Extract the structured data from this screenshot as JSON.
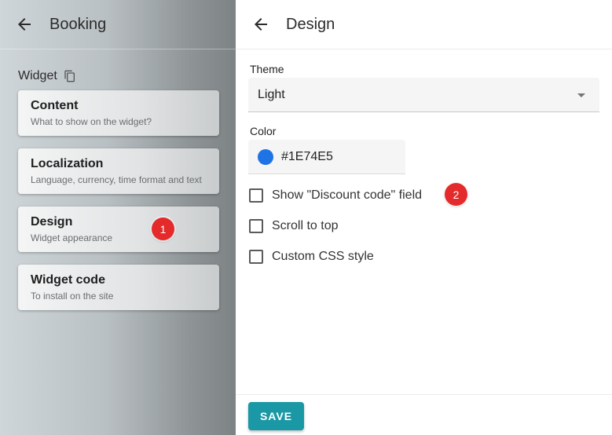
{
  "left_panel": {
    "title": "Booking",
    "section_label": "Widget",
    "cards": [
      {
        "title": "Content",
        "subtitle": "What to show on the widget?"
      },
      {
        "title": "Localization",
        "subtitle": "Language, currency, time format and text"
      },
      {
        "title": "Design",
        "subtitle": "Widget appearance"
      },
      {
        "title": "Widget code",
        "subtitle": "To install on the site"
      }
    ]
  },
  "right_panel": {
    "title": "Design",
    "theme": {
      "label": "Theme",
      "value": "Light"
    },
    "color": {
      "label": "Color",
      "value": "#1E74E5",
      "swatch": "#1E74E5"
    },
    "checkboxes": [
      {
        "label": "Show \"Discount code\" field",
        "checked": false
      },
      {
        "label": "Scroll to top",
        "checked": false
      },
      {
        "label": "Custom CSS style",
        "checked": false
      }
    ],
    "save_label": "SAVE"
  },
  "annotations": {
    "badge_1": "1",
    "badge_2": "2"
  },
  "colors": {
    "accent": "#1A98A5",
    "badge": "#E42A2A",
    "swatch": "#1E74E5"
  },
  "icons": {
    "back": "arrow-left-icon",
    "copy": "copy-icon",
    "dropdown": "chevron-down-icon"
  }
}
